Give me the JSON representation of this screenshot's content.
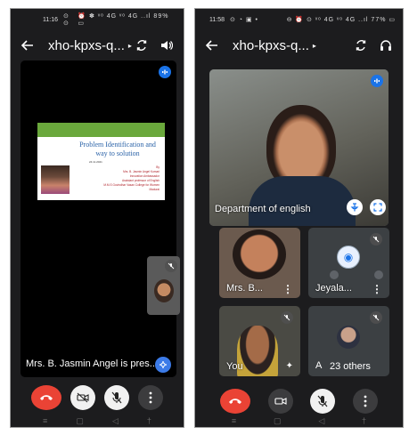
{
  "left": {
    "status": {
      "time": "11:16",
      "mid": "⊙ ⊙",
      "sys": "⏰ ✽ ᵛᵒ 4G ᵛᵒ 4G ..ıl 89% ▭"
    },
    "topbar": {
      "meeting_code": "xho-kpxs-q...",
      "caret": "▸"
    },
    "slide": {
      "title": "Problem Identification and way to solution",
      "date": "24.11.2021",
      "presenter_info": "By\nMrs. B. Jasmin Angel Kumari\nInnovation Ambassador\nAssistant professor of English\nM.M.S Govindhar Vasan College for Women\nMadurai"
    },
    "caption": "Mrs. B. Jasmin Angel is pres..."
  },
  "right": {
    "status": {
      "time": "11:58",
      "mid": "⊙ ◔ ▣ •",
      "sys": "⊖ ⏰ ⊙ ᵛᵒ 4G ᵛᵒ 4G ..ıl 77% ▭"
    },
    "topbar": {
      "meeting_code": "xho-kpxs-q...",
      "caret": "▸"
    },
    "main_label": "Department of english",
    "tiles": [
      {
        "name": "Mrs. B..."
      },
      {
        "name": "Jeyala..."
      },
      {
        "name": "You"
      },
      {
        "name": "A",
        "others": "23 others"
      }
    ]
  },
  "icons": {
    "back": "back-arrow-icon",
    "camera_switch": "camera-switch-icon",
    "speaker": "speaker-icon",
    "headphones": "headphones-icon",
    "end_call": "end-call-icon",
    "camera_off": "camera-off-icon",
    "camera": "camera-icon",
    "mic_off": "mic-off-icon",
    "more": "more-vert-icon"
  },
  "colors": {
    "end_call": "#ea4335",
    "accent_blue": "#1a73e8"
  }
}
